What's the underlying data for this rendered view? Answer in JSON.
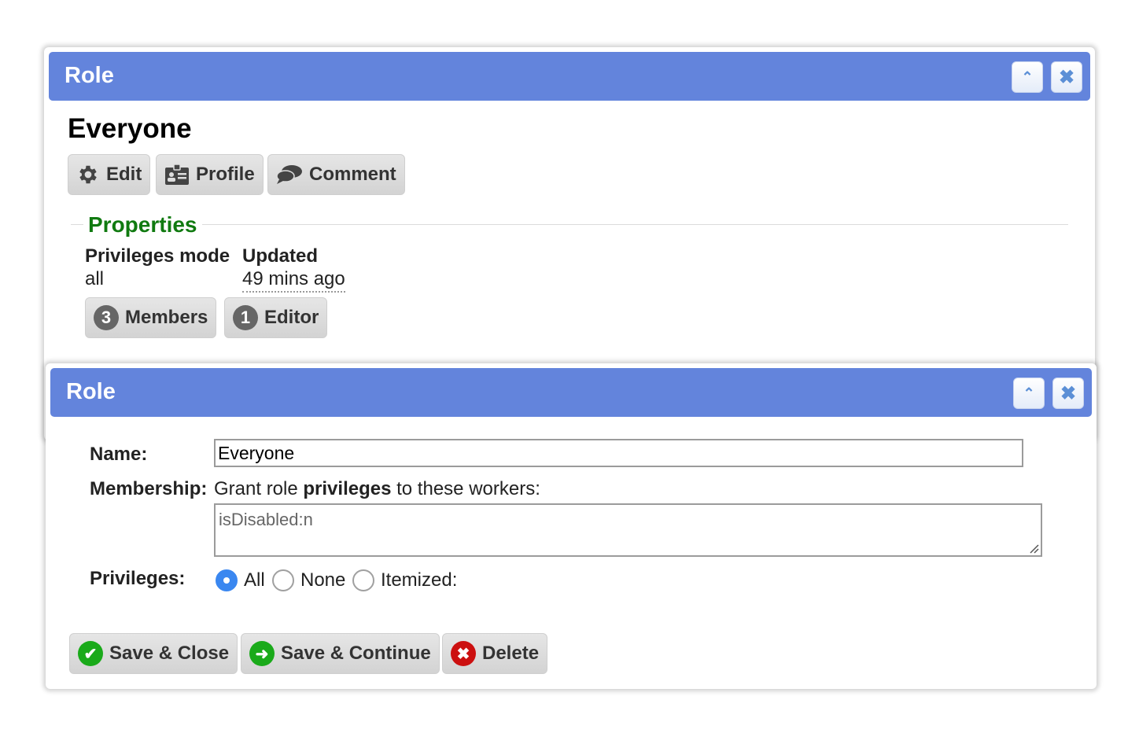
{
  "view_panel": {
    "title": "Role",
    "collapse_icon": "chevron-up-icon",
    "close_icon": "close-icon",
    "record_name": "Everyone",
    "actions": {
      "edit": "Edit",
      "profile": "Profile",
      "comment": "Comment"
    },
    "properties": {
      "legend": "Properties",
      "privileges_mode_label": "Privileges mode",
      "privileges_mode_value": "all",
      "updated_label": "Updated",
      "updated_value": "49 mins ago"
    },
    "links": {
      "members_count": "3",
      "members_label": "Members",
      "editor_count": "1",
      "editor_label": "Editor"
    }
  },
  "edit_panel": {
    "title": "Role",
    "collapse_icon": "chevron-up-icon",
    "close_icon": "close-icon",
    "name_label": "Name:",
    "name_value": "Everyone",
    "membership_label": "Membership:",
    "membership_prefix": "Grant role",
    "membership_bold": "privileges",
    "membership_suffix": "to these workers:",
    "membership_query": "isDisabled:n",
    "privileges_label": "Privileges:",
    "privileges_options": [
      "All",
      "None",
      "Itemized:"
    ],
    "privileges_selected": "All",
    "buttons": {
      "save_close": "Save & Close",
      "save_continue": "Save & Continue",
      "delete": "Delete"
    }
  },
  "colors": {
    "titlebar": "#6384dc",
    "legend": "#107a10",
    "radio_checked": "#3a87f0",
    "save_green": "#1aaa1a",
    "delete_red": "#cc1010"
  }
}
